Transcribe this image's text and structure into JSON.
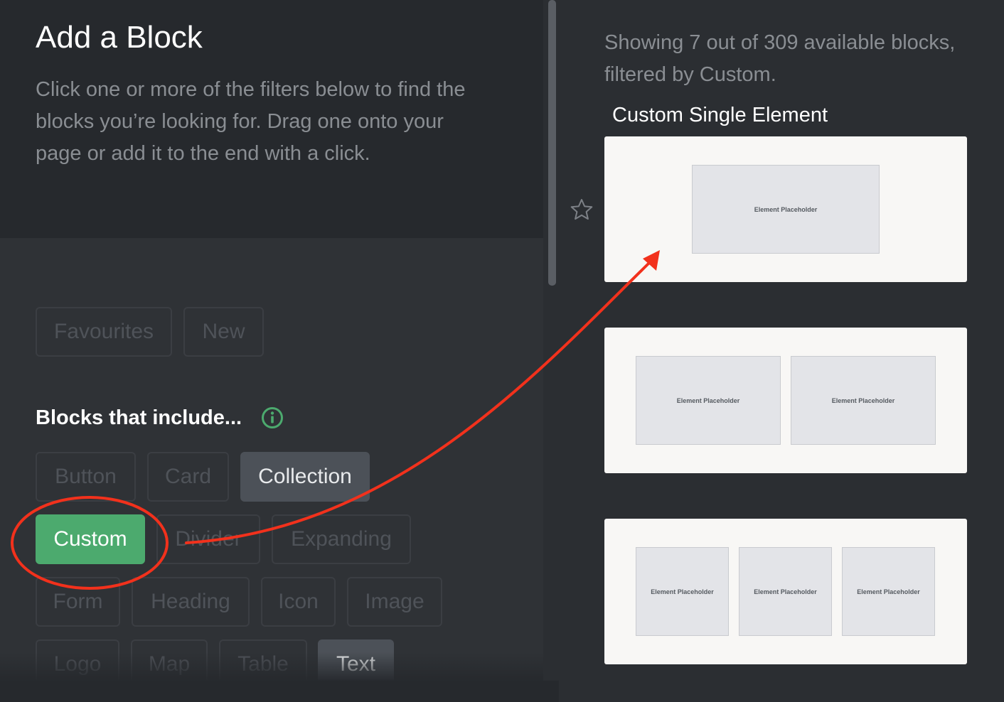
{
  "panel": {
    "title": "Add a Block",
    "description": "Click one or more of the filters below to find the blocks you’re looking for. Drag one onto your page or add it to the end with a click."
  },
  "filters": {
    "favourites": "Favourites",
    "new": "New",
    "section_label": "Blocks that include...",
    "button": "Button",
    "card": "Card",
    "collection": "Collection",
    "custom": "Custom",
    "divider": "Divider",
    "expanding": "Expanding",
    "form": "Form",
    "heading": "Heading",
    "icon": "Icon",
    "image": "Image",
    "logo": "Logo",
    "map": "Map",
    "table": "Table",
    "text": "Text"
  },
  "results": {
    "summary": "Showing 7 out of 309 available blocks, filtered by Custom.",
    "block_title": "Custom Single Element",
    "placeholder_label": "Element Placeholder"
  },
  "colors": {
    "accent_green": "#4caa6e",
    "annotation_red": "#f2311c"
  },
  "icons": {
    "info": "info-icon",
    "favourite": "star-icon"
  }
}
